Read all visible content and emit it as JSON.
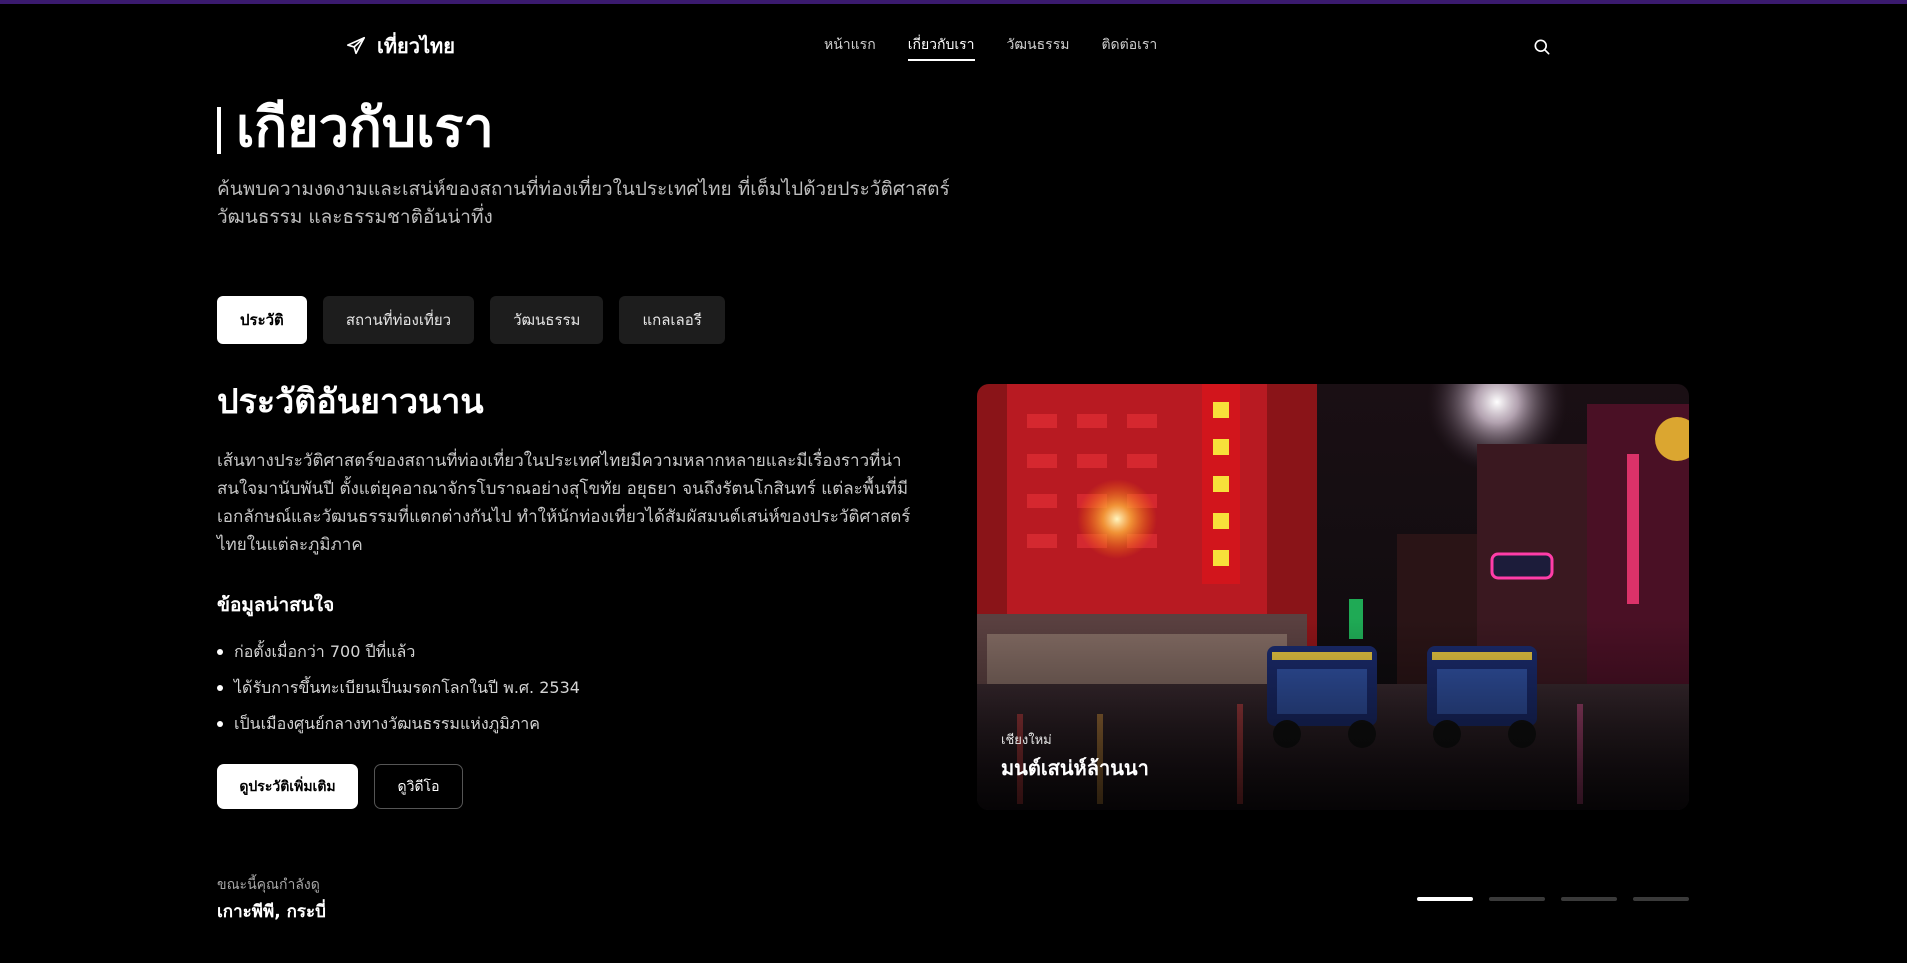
{
  "brand": {
    "name": "เที่ยวไทย",
    "logo_icon": "plane-icon"
  },
  "nav": {
    "items": [
      {
        "label": "หน้าแรก",
        "active": false
      },
      {
        "label": "เกี่ยวกับเรา",
        "active": true
      },
      {
        "label": "วัฒนธรรม",
        "active": false
      },
      {
        "label": "ติดต่อเรา",
        "active": false
      }
    ],
    "search_icon": "search-icon"
  },
  "hero": {
    "title": "เกียวกับเรา",
    "subtitle_line1": "ค้นพบความงดงามและเสน่ห์ของสถานที่ท่องเที่ยวในประเทศไทย ที่เต็มไปด้วยประวัติศาสตร์",
    "subtitle_line2": "วัฒนธรรม และธรรมชาติอันน่าทึ่ง"
  },
  "tabs": [
    {
      "label": "ประวัติ",
      "active": true
    },
    {
      "label": "สถานที่ท่องเที่ยว",
      "active": false
    },
    {
      "label": "วัฒนธรรม",
      "active": false
    },
    {
      "label": "แกลเลอรี",
      "active": false
    }
  ],
  "content": {
    "title": "ประวัติอันยาวนาน",
    "body": "เส้นทางประวัติศาสตร์ของสถานที่ท่องเที่ยวในประเทศไทยมีความหลากหลายและมีเรื่องราวที่น่าสนใจมานับพันปี ตั้งแต่ยุคอาณาจักรโบราณอย่างสุโขทัย อยุธยา จนถึงรัตนโกสินทร์ แต่ละพื้นที่มีเอกลักษณ์และวัฒนธรรมที่แตกต่างกันไป ทำให้นักท่องเที่ยวได้สัมผัสมนต์เสน่ห์ของประวัติศาสตร์ไทยในแต่ละภูมิภาค",
    "facts_title": "ข้อมูลน่าสนใจ",
    "facts": [
      "ก่อตั้งเมื่อกว่า 700 ปีที่แล้ว",
      "ได้รับการขึ้นทะเบียนเป็นมรดกโลกในปี พ.ศ. 2534",
      "เป็นเมืองศูนย์กลางทางวัฒนธรรมแห่งภูมิภาค"
    ],
    "primary_button": "ดูประวัติเพิ่มเติม",
    "secondary_button": "ดูวิดีโอ"
  },
  "image_card": {
    "subtitle": "เชียงใหม่",
    "title": "มนต์เสน่ห์ล้านนา"
  },
  "footer": {
    "now_label": "ขณะนี้คุณกำลังดู",
    "now_value": "เกาะพีพี, กระบี่",
    "slide_count": 4,
    "active_slide": 1
  }
}
